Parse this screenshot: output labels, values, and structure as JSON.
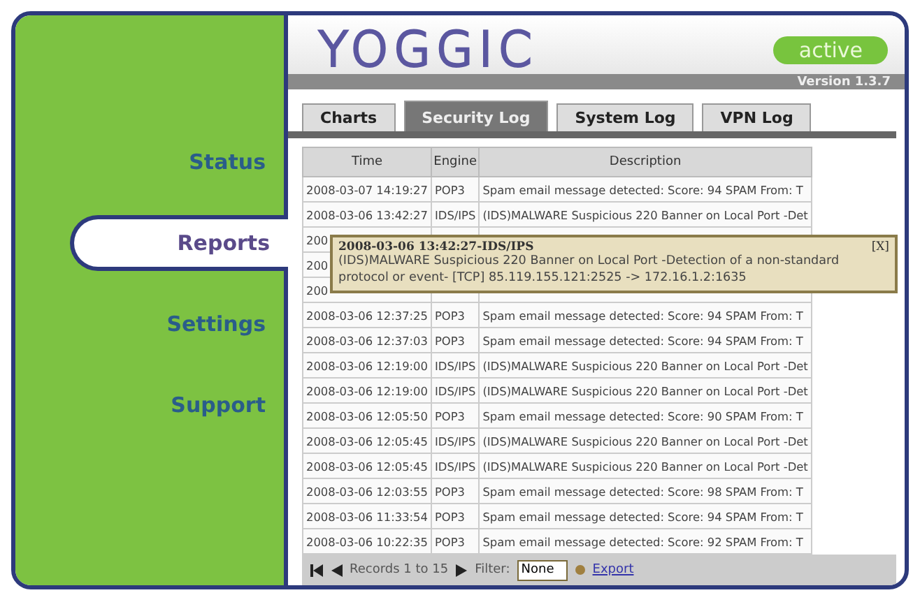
{
  "sidebar": {
    "items": [
      {
        "label": "Status",
        "selected": false
      },
      {
        "label": "Reports",
        "selected": true
      },
      {
        "label": "Settings",
        "selected": false
      },
      {
        "label": "Support",
        "selected": false
      }
    ]
  },
  "header": {
    "logo": "YOGGIC",
    "status": "active",
    "version": "Version 1.3.7"
  },
  "tabs": [
    {
      "label": "Charts",
      "selected": false
    },
    {
      "label": "Security Log",
      "selected": true
    },
    {
      "label": "System Log",
      "selected": false
    },
    {
      "label": "VPN Log",
      "selected": false
    }
  ],
  "table": {
    "columns": [
      "Time",
      "Engine",
      "Description"
    ],
    "rows": [
      [
        "2008-03-07 14:19:27",
        "POP3",
        "Spam email message detected: Score: 94 SPAM From: T"
      ],
      [
        "2008-03-06 13:42:27",
        "IDS/IPS",
        "(IDS)MALWARE Suspicious 220 Banner on Local Port -Det"
      ],
      [
        "200"
      ],
      [
        "200"
      ],
      [
        "200"
      ],
      [
        "2008-03-06 12:37:25",
        "POP3",
        "Spam email message detected: Score: 94 SPAM From: T"
      ],
      [
        "2008-03-06 12:37:03",
        "POP3",
        "Spam email message detected: Score: 94 SPAM From: T"
      ],
      [
        "2008-03-06 12:19:00",
        "IDS/IPS",
        "(IDS)MALWARE Suspicious 220 Banner on Local Port -Det"
      ],
      [
        "2008-03-06 12:19:00",
        "IDS/IPS",
        "(IDS)MALWARE Suspicious 220 Banner on Local Port -Det"
      ],
      [
        "2008-03-06 12:05:50",
        "POP3",
        "Spam email message detected: Score: 90 SPAM From: T"
      ],
      [
        "2008-03-06 12:05:45",
        "IDS/IPS",
        "(IDS)MALWARE Suspicious 220 Banner on Local Port -Det"
      ],
      [
        "2008-03-06 12:05:45",
        "IDS/IPS",
        "(IDS)MALWARE Suspicious 220 Banner on Local Port -Det"
      ],
      [
        "2008-03-06 12:03:55",
        "POP3",
        "Spam email message detected: Score: 98 SPAM From: T"
      ],
      [
        "2008-03-06 11:33:54",
        "POP3",
        "Spam email message detected: Score: 94 SPAM From: T"
      ],
      [
        "2008-03-06 10:22:35",
        "POP3",
        "Spam email message detected: Score: 92 SPAM From: T"
      ]
    ]
  },
  "tooltip": {
    "title": "2008-03-06 13:42:27-IDS/IPS",
    "close": "[X]",
    "text": "(IDS)MALWARE Suspicious 220 Banner on Local Port -Detection of a non-standard protocol or event- [TCP] 85.119.155.121:2525 -> 172.16.1.2:1635"
  },
  "footer": {
    "records": "Records 1 to 15",
    "filter_label": "Filter:",
    "filter_value": "None",
    "export": "Export"
  }
}
